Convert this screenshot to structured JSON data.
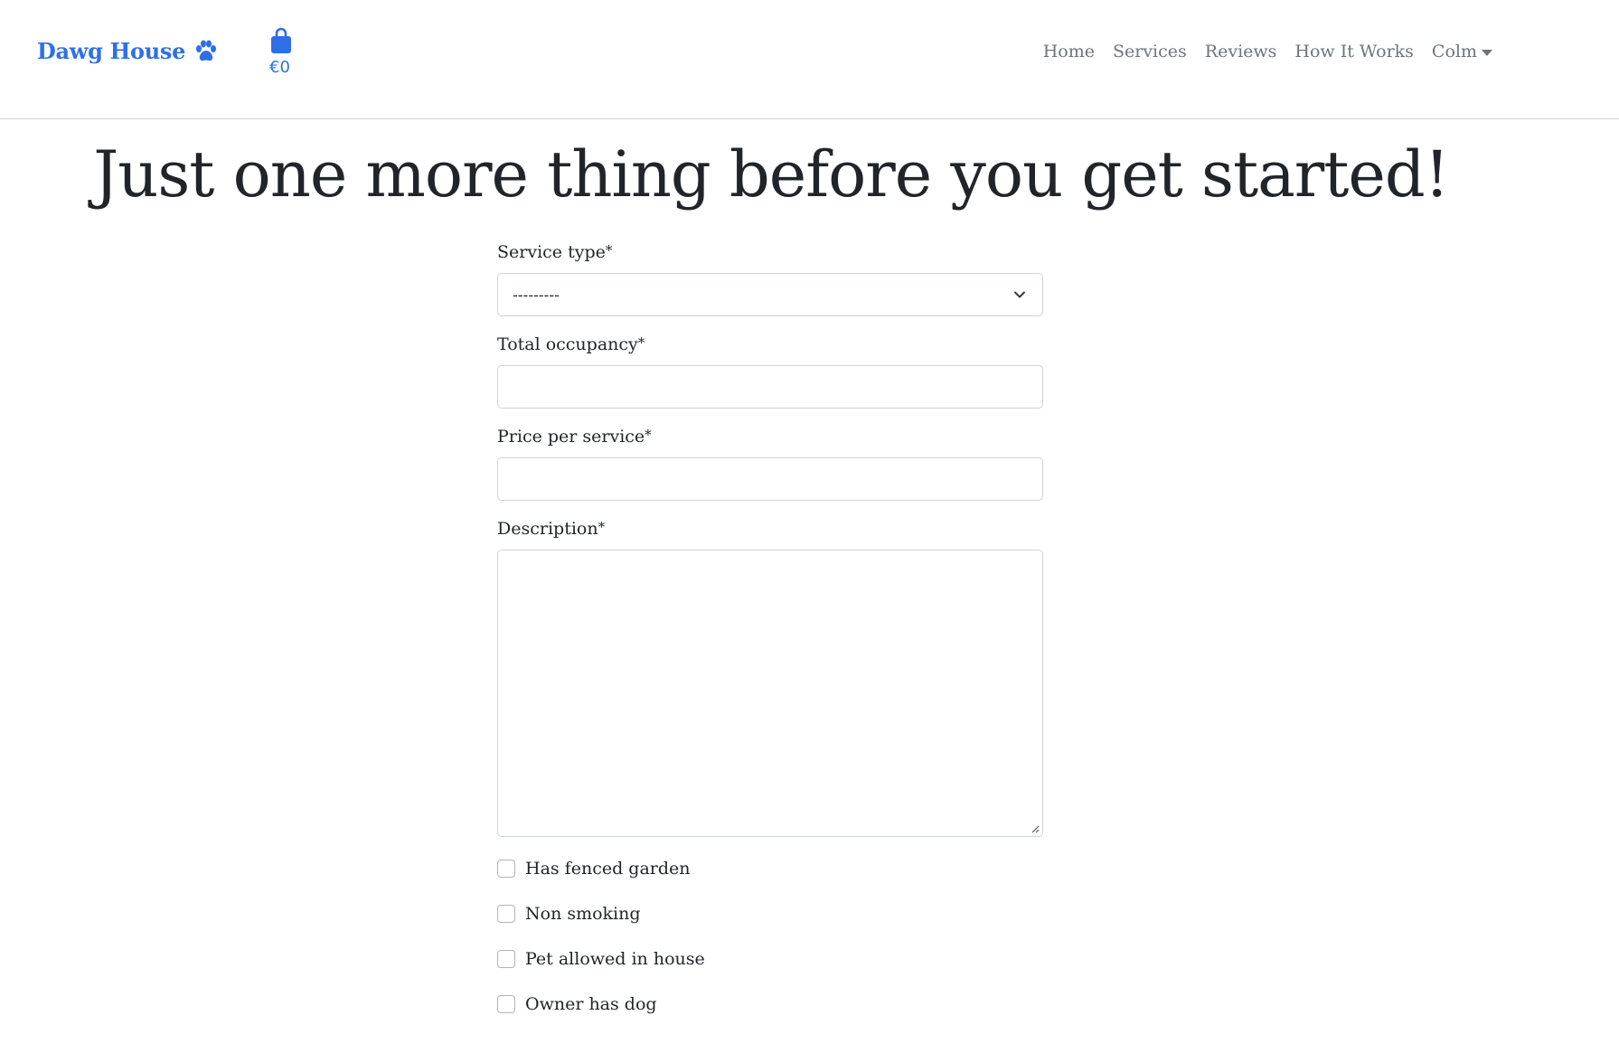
{
  "nav": {
    "brand": "Dawg House",
    "brand_icon": "paw-icon",
    "bag_icon": "shopping-bag-icon",
    "bag_total": "€0",
    "links": [
      "Home",
      "Services",
      "Reviews",
      "How It Works"
    ],
    "user_menu": "Colm",
    "accent_color": "#2f6fe6"
  },
  "page": {
    "title": "Just one more thing before you get started!"
  },
  "form": {
    "service_type": {
      "label": "Service type",
      "required_mark": "*",
      "value": "---------"
    },
    "total_occupancy": {
      "label": "Total occupancy",
      "required_mark": "*",
      "value": ""
    },
    "price_per_service": {
      "label": "Price per service",
      "required_mark": "*",
      "value": ""
    },
    "description": {
      "label": "Description",
      "required_mark": "*",
      "value": ""
    },
    "checkboxes": [
      {
        "label": "Has fenced garden",
        "checked": false
      },
      {
        "label": "Non smoking",
        "checked": false
      },
      {
        "label": "Pet allowed in house",
        "checked": false
      },
      {
        "label": "Owner has dog",
        "checked": false
      }
    ]
  }
}
